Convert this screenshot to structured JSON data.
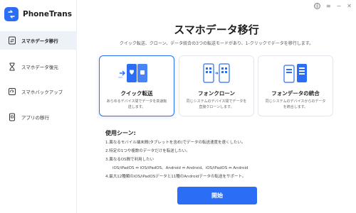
{
  "app": {
    "name": "PhoneTrans"
  },
  "window": {
    "info": "i",
    "menu": "≡",
    "minimize": "−",
    "close": "✕"
  },
  "sidebar": {
    "items": [
      {
        "label": "スマホデータ移行",
        "icon": "transfer-icon",
        "active": true
      },
      {
        "label": "スマホデータ復元",
        "icon": "hourglass-icon",
        "active": false
      },
      {
        "label": "スマホバックアップ",
        "icon": "backup-icon",
        "active": false
      },
      {
        "label": "アプリの移行",
        "icon": "app-transfer-icon",
        "active": false
      }
    ]
  },
  "main": {
    "title": "スマホデータ移行",
    "subtitle": "クイック転送、クローン、データ統合の3つの転送モードがあり、1-クリックでデータを移行します。",
    "cards": [
      {
        "title": "クイック転送",
        "desc": "あらゆるデバイス間でデータを高速転送します。",
        "selected": true
      },
      {
        "title": "フォンクローン",
        "desc": "同じシステムのデバイス間でデータを直接クローンします。",
        "selected": false
      },
      {
        "title": "フォンデータの統合",
        "desc": "同じシステムのデバイスからのデータを統合します。",
        "selected": false
      }
    ],
    "usage": {
      "heading": "使用シーン:",
      "lines": [
        "1.異なるモバイル端末間(タブレットを含め)でデータの転送速度を速くしたい。",
        "2.特定の1つや複数のデータだけを転送したい。",
        "3.異なるOS間で利用したい",
        "iOS/iPadOS ⇔ iOS/iPadOS、Android ⇔ Android、iOS/iPadOS ⇔ Android",
        "4.最大12種類のiOS/iPadOSデータと11種のAndroidデータの転送をサポート。"
      ]
    },
    "start_label": "開始"
  },
  "colors": {
    "accent": "#2b6ef5",
    "sidebar_active": "#edf1f8"
  }
}
